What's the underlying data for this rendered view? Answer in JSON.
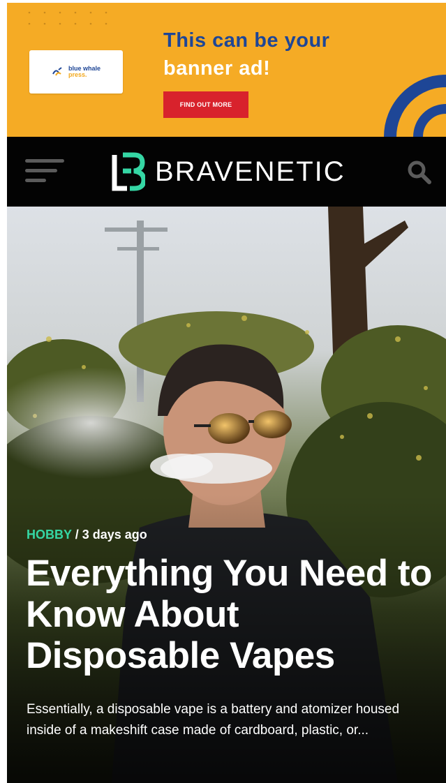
{
  "banner_ad": {
    "logo_text_line1": "blue whale",
    "logo_text_line2": "press.",
    "headline_line1": "This can be your",
    "headline_line2": "banner ad!",
    "cta_label": "FIND OUT MORE",
    "colors": {
      "background": "#f5ab25",
      "headline_blue": "#1e4696",
      "cta_red": "#d8222c"
    }
  },
  "header": {
    "site_name": "BRAVENETIC",
    "menu_icon": "hamburger-menu-icon",
    "search_icon": "search-icon",
    "colors": {
      "background": "#030303",
      "accent": "#35d6a4"
    }
  },
  "hero": {
    "category": "HOBBY",
    "separator": "/",
    "time_ago": "3 days ago",
    "title": "Everything You Need to Know About Disposable Vapes",
    "excerpt": "Essentially, a disposable vape is a battery and atomizer housed inside of a makeshift case made of cardboard, plastic, or..."
  }
}
